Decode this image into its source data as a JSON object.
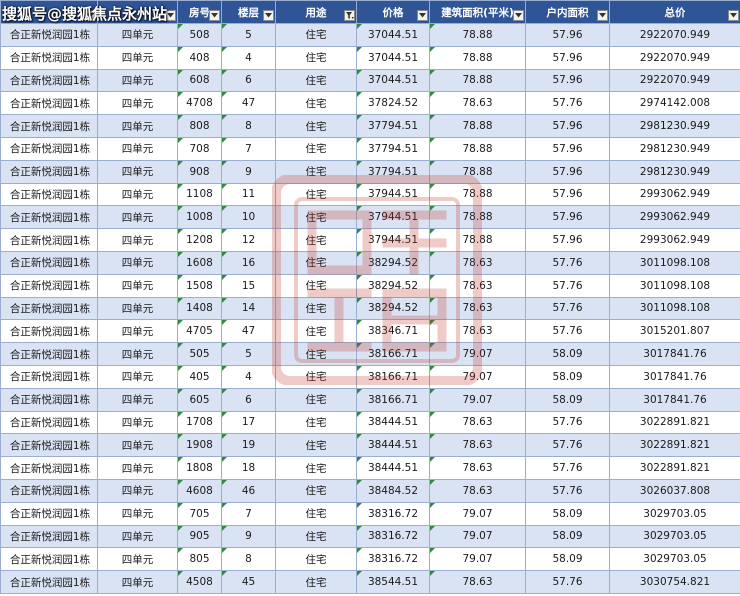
{
  "watermark": "搜狐号@搜狐焦点永州站",
  "columns": [
    "",
    "",
    "房号",
    "楼层",
    "用途",
    "价格",
    "建筑面积(平米)",
    "户内面积",
    "总价"
  ],
  "colors": {
    "header_bg": "#2f5597",
    "row_band": "#dae3f3",
    "cell_marker": "#2e8b3e",
    "stamp": "#c0392b"
  },
  "icons": {
    "filter": "filter-dropdown-icon",
    "filter_active": "filter-applied-icon"
  },
  "rows": [
    [
      "合正新悦润园1栋",
      "四单元",
      "508",
      "5",
      "住宅",
      "37044.51",
      "78.88",
      "57.96",
      "2922070.949"
    ],
    [
      "合正新悦润园1栋",
      "四单元",
      "408",
      "4",
      "住宅",
      "37044.51",
      "78.88",
      "57.96",
      "2922070.949"
    ],
    [
      "合正新悦润园1栋",
      "四单元",
      "608",
      "6",
      "住宅",
      "37044.51",
      "78.88",
      "57.96",
      "2922070.949"
    ],
    [
      "合正新悦润园1栋",
      "四单元",
      "4708",
      "47",
      "住宅",
      "37824.52",
      "78.63",
      "57.76",
      "2974142.008"
    ],
    [
      "合正新悦润园1栋",
      "四单元",
      "808",
      "8",
      "住宅",
      "37794.51",
      "78.88",
      "57.96",
      "2981230.949"
    ],
    [
      "合正新悦润园1栋",
      "四单元",
      "708",
      "7",
      "住宅",
      "37794.51",
      "78.88",
      "57.96",
      "2981230.949"
    ],
    [
      "合正新悦润园1栋",
      "四单元",
      "908",
      "9",
      "住宅",
      "37794.51",
      "78.88",
      "57.96",
      "2981230.949"
    ],
    [
      "合正新悦润园1栋",
      "四单元",
      "1108",
      "11",
      "住宅",
      "37944.51",
      "78.88",
      "57.96",
      "2993062.949"
    ],
    [
      "合正新悦润园1栋",
      "四单元",
      "1008",
      "10",
      "住宅",
      "37944.51",
      "78.88",
      "57.96",
      "2993062.949"
    ],
    [
      "合正新悦润园1栋",
      "四单元",
      "1208",
      "12",
      "住宅",
      "37944.51",
      "78.88",
      "57.96",
      "2993062.949"
    ],
    [
      "合正新悦润园1栋",
      "四单元",
      "1608",
      "16",
      "住宅",
      "38294.52",
      "78.63",
      "57.76",
      "3011098.108"
    ],
    [
      "合正新悦润园1栋",
      "四单元",
      "1508",
      "15",
      "住宅",
      "38294.52",
      "78.63",
      "57.76",
      "3011098.108"
    ],
    [
      "合正新悦润园1栋",
      "四单元",
      "1408",
      "14",
      "住宅",
      "38294.52",
      "78.63",
      "57.76",
      "3011098.108"
    ],
    [
      "合正新悦润园1栋",
      "四单元",
      "4705",
      "47",
      "住宅",
      "38346.71",
      "78.63",
      "57.76",
      "3015201.807"
    ],
    [
      "合正新悦润园1栋",
      "四单元",
      "505",
      "5",
      "住宅",
      "38166.71",
      "79.07",
      "58.09",
      "3017841.76"
    ],
    [
      "合正新悦润园1栋",
      "四单元",
      "405",
      "4",
      "住宅",
      "38166.71",
      "79.07",
      "58.09",
      "3017841.76"
    ],
    [
      "合正新悦润园1栋",
      "四单元",
      "605",
      "6",
      "住宅",
      "38166.71",
      "79.07",
      "58.09",
      "3017841.76"
    ],
    [
      "合正新悦润园1栋",
      "四单元",
      "1708",
      "17",
      "住宅",
      "38444.51",
      "78.63",
      "57.76",
      "3022891.821"
    ],
    [
      "合正新悦润园1栋",
      "四单元",
      "1908",
      "19",
      "住宅",
      "38444.51",
      "78.63",
      "57.76",
      "3022891.821"
    ],
    [
      "合正新悦润园1栋",
      "四单元",
      "1808",
      "18",
      "住宅",
      "38444.51",
      "78.63",
      "57.76",
      "3022891.821"
    ],
    [
      "合正新悦润园1栋",
      "四单元",
      "4608",
      "46",
      "住宅",
      "38484.52",
      "78.63",
      "57.76",
      "3026037.808"
    ],
    [
      "合正新悦润园1栋",
      "四单元",
      "705",
      "7",
      "住宅",
      "38316.72",
      "79.07",
      "58.09",
      "3029703.05"
    ],
    [
      "合正新悦润园1栋",
      "四单元",
      "905",
      "9",
      "住宅",
      "38316.72",
      "79.07",
      "58.09",
      "3029703.05"
    ],
    [
      "合正新悦润园1栋",
      "四单元",
      "805",
      "8",
      "住宅",
      "38316.72",
      "79.07",
      "58.09",
      "3029703.05"
    ],
    [
      "合正新悦润园1栋",
      "四单元",
      "4508",
      "45",
      "住宅",
      "38544.51",
      "78.63",
      "57.76",
      "3030754.821"
    ]
  ]
}
